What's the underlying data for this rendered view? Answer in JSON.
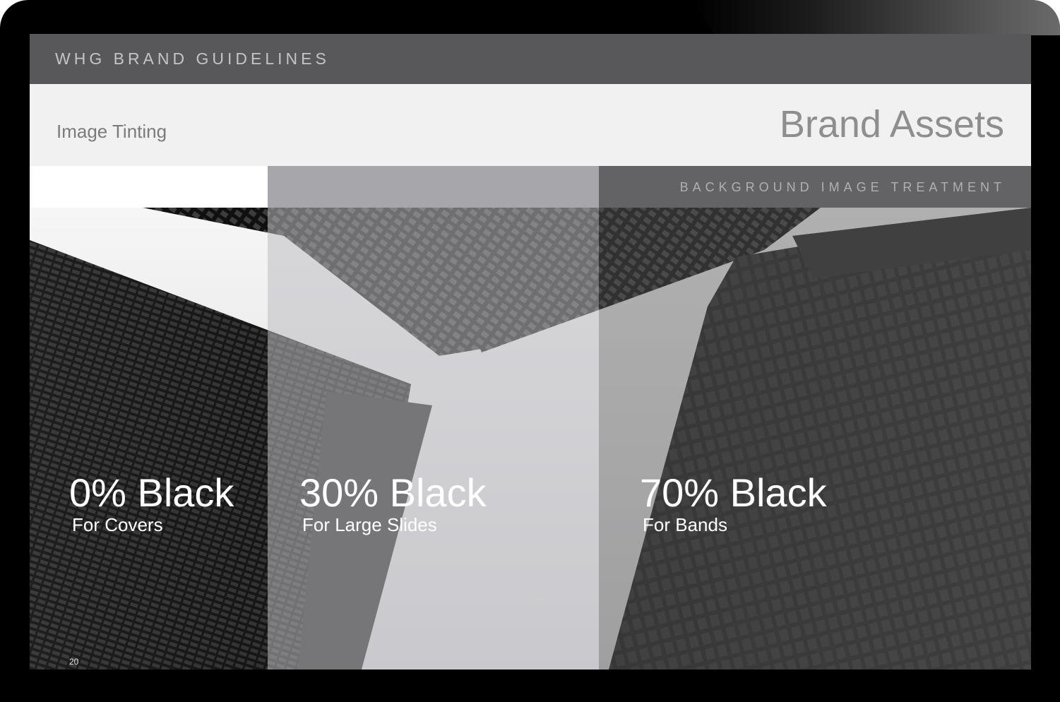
{
  "header": {
    "brand_title": "WHG BRAND GUIDELINES",
    "subtitle": "Image Tinting",
    "page_title": "Brand Assets",
    "band_label": "BACKGROUND IMAGE TREATMENT"
  },
  "treatments": [
    {
      "title": "0% Black",
      "usage": "For Covers"
    },
    {
      "title": "30% Black",
      "usage": "For Large Slides"
    },
    {
      "title": "70% Black",
      "usage": "For Bands"
    }
  ],
  "page_number": "20"
}
